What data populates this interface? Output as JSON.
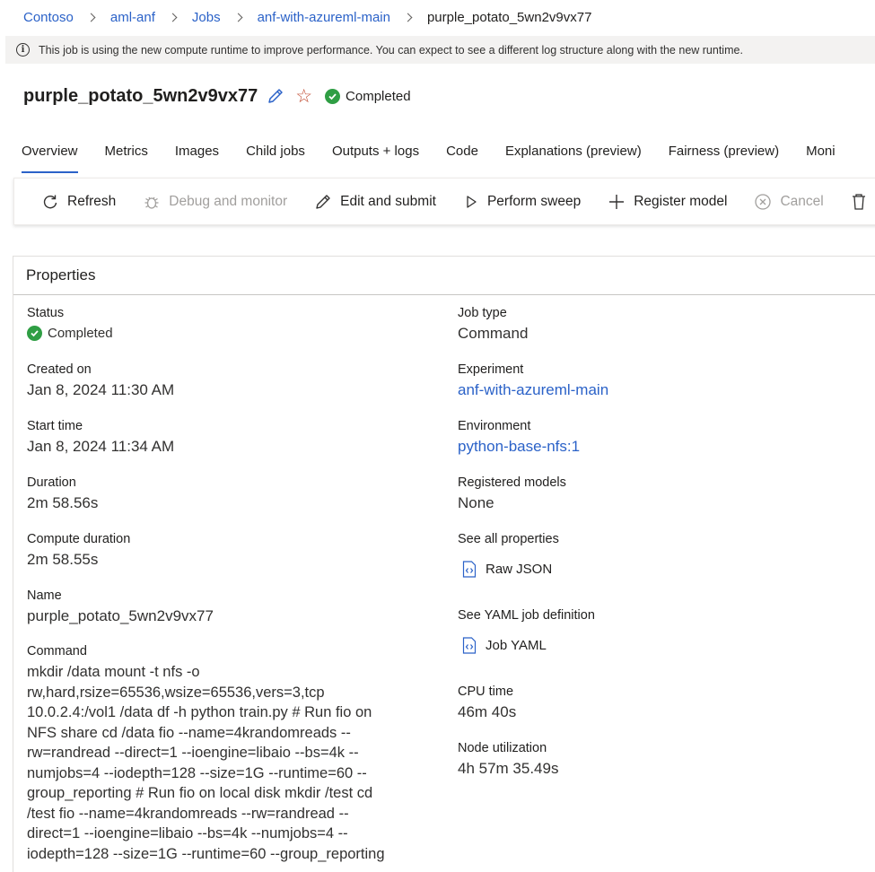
{
  "breadcrumb": {
    "items": [
      "Contoso",
      "aml-anf",
      "Jobs",
      "anf-with-azureml-main"
    ],
    "current": "purple_potato_5wn2v9vx77"
  },
  "banner": {
    "text": "This job is using the new compute runtime to improve performance. You can expect to see a different log structure along with the new runtime."
  },
  "header": {
    "title": "purple_potato_5wn2v9vx77",
    "status": "Completed",
    "status_color": "#2f9e44",
    "icons": [
      "edit-icon",
      "star-icon",
      "check-circle-icon"
    ]
  },
  "tabs": [
    "Overview",
    "Metrics",
    "Images",
    "Child jobs",
    "Outputs + logs",
    "Code",
    "Explanations (preview)",
    "Fairness (preview)",
    "Moni"
  ],
  "toolbar": {
    "refresh": "Refresh",
    "debug": "Debug and monitor",
    "edit_submit": "Edit and submit",
    "sweep": "Perform sweep",
    "register": "Register model",
    "cancel": "Cancel"
  },
  "properties": {
    "title": "Properties",
    "status_label": "Status",
    "status_value": "Completed",
    "created_label": "Created on",
    "created_value": "Jan 8, 2024 11:30 AM",
    "start_label": "Start time",
    "start_value": "Jan 8, 2024 11:34 AM",
    "duration_label": "Duration",
    "duration_value": "2m 58.56s",
    "compute_duration_label": "Compute duration",
    "compute_duration_value": "2m 58.55s",
    "name_label": "Name",
    "name_value": "purple_potato_5wn2v9vx77",
    "command_label": "Command",
    "command_lines": [
      "mkdir /data mount -t nfs -o",
      "rw,hard,rsize=65536,wsize=65536,vers=3,tcp",
      "10.0.2.4:/vol1 /data df -h python train.py # Run fio on",
      "NFS share cd /data fio --name=4krandomreads --",
      "rw=randread --direct=1 --ioengine=libaio --bs=4k --",
      "numjobs=4 --iodepth=128 --size=1G --runtime=60 --",
      "group_reporting # Run fio on local disk mkdir /test cd",
      "/test fio --name=4krandomreads --rw=randread --",
      "direct=1 --ioengine=libaio --bs=4k --numjobs=4 --",
      "iodepth=128 --size=1G --runtime=60 --group_reporting"
    ],
    "job_type_label": "Job type",
    "job_type_value": "Command",
    "experiment_label": "Experiment",
    "experiment_value": "anf-with-azureml-main",
    "environment_label": "Environment",
    "environment_value": "python-base-nfs:1",
    "registered_models_label": "Registered models",
    "registered_models_value": "None",
    "all_props_label": "See all properties",
    "raw_json": "Raw JSON",
    "yaml_label": "See YAML job definition",
    "job_yaml": "Job YAML",
    "cpu_label": "CPU time",
    "cpu_value": "46m 40s",
    "node_label": "Node utilization",
    "node_value": "4h 57m 35.49s"
  }
}
